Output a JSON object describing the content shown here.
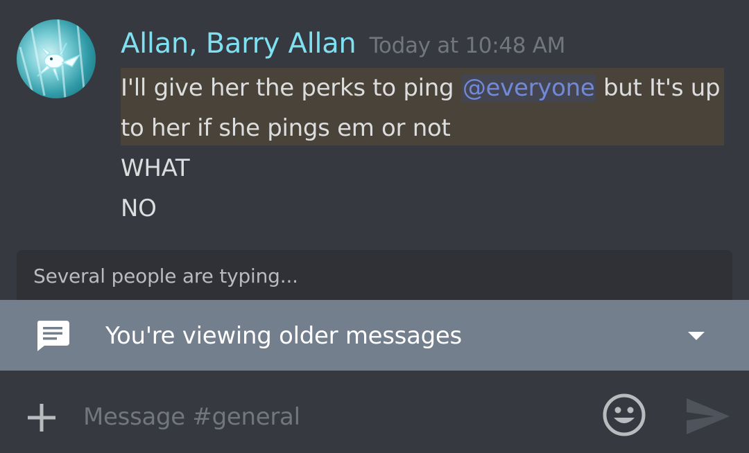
{
  "message": {
    "author": "Allan, Barry Allan",
    "timestamp": "Today at 10:48 AM",
    "line1_prefix": "I'll give her the perks to ping ",
    "mention": "@everyone",
    "line1_suffix": " but It's up",
    "line2": "to her if she pings em or not",
    "line3": "WHAT",
    "line4": "NO"
  },
  "typing": {
    "text": "Several people are typing..."
  },
  "banner": {
    "text": "You're viewing older messages",
    "icon": "chat-icon",
    "caret": "chevron-down-icon"
  },
  "composer": {
    "placeholder": "Message #general",
    "value": ""
  },
  "icons": {
    "attach": "plus-icon",
    "emoji": "emoji-icon",
    "send": "send-icon"
  },
  "colors": {
    "background": "#36393f",
    "username": "#7ee0f0",
    "mention": "#7289da",
    "highlight": "#4a4339",
    "banner": "#747f8d"
  }
}
